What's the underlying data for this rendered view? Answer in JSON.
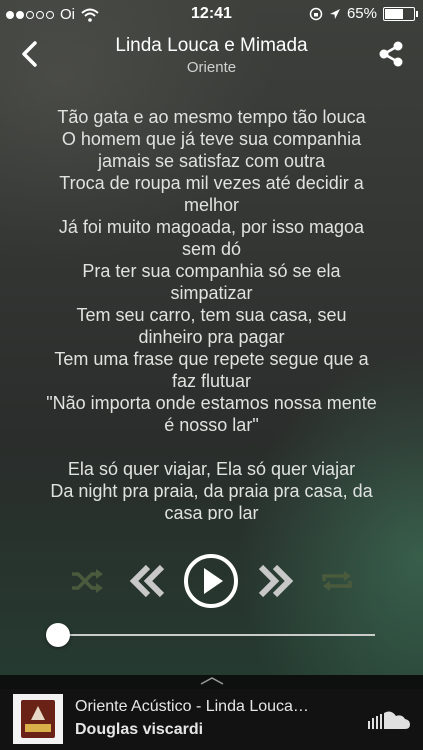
{
  "status_bar": {
    "carrier": "Oi",
    "time": "12:41",
    "battery": "65%",
    "battery_level": 0.65
  },
  "header": {
    "title": "Linda Louca e Mimada",
    "subtitle": "Oriente"
  },
  "lyrics": {
    "lines": [
      "Tão gata e ao mesmo tempo tão louca",
      "O homem que já teve sua companhia",
      "jamais se satisfaz com outra",
      "Troca de roupa mil vezes até decidir a",
      "melhor",
      "Já foi muito magoada, por isso magoa",
      "sem dó",
      "Pra ter sua companhia só se ela",
      "simpatizar",
      "Tem seu carro, tem sua casa, seu",
      "dinheiro pra pagar",
      "Tem uma frase que repete segue que a",
      "faz flutuar",
      "\"Não importa onde estamos nossa mente",
      "é nosso lar\"",
      "",
      "Ela só quer viajar, Ela só quer viajar",
      "Da night pra praia, da praia pra casa, da",
      "casa pro lar"
    ]
  },
  "player": {
    "progress": 0.02,
    "icons": {
      "shuffle": "shuffle-icon",
      "previous": "previous-icon",
      "play": "play-icon",
      "next": "next-icon",
      "repeat": "repeat-icon"
    },
    "colors": {
      "inactive": "#4a5a3c",
      "active": "#ffffff"
    }
  },
  "mini_player": {
    "title": "Oriente Acústico - Linda Louca…",
    "artist": "Douglas viscardi",
    "service_icon": "soundcloud-icon"
  }
}
